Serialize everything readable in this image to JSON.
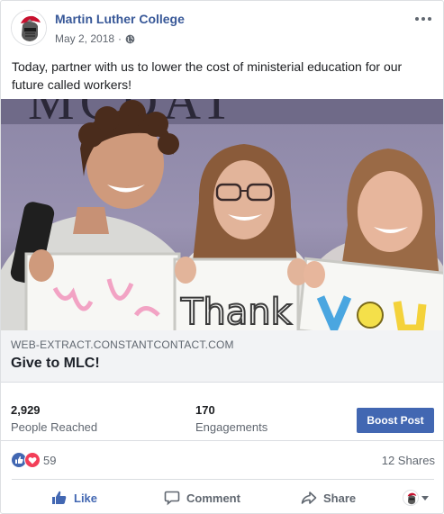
{
  "post": {
    "page_name": "Martin Luther College",
    "date": "May 2, 2018",
    "separator": "·",
    "text": "Today, partner with us to lower the cost of ministerial education for our future called workers!",
    "photo_sign_text": "MCDAT",
    "photo_card_text": "Thank"
  },
  "link_preview": {
    "domain": "WEB-EXTRACT.CONSTANTCONTACT.COM",
    "title": "Give to MLC!"
  },
  "insights": {
    "reached_value": "2,929",
    "reached_label": "People Reached",
    "engagements_value": "170",
    "engagements_label": "Engagements",
    "boost_label": "Boost Post"
  },
  "reactions": {
    "count": "59",
    "shares": "12 Shares",
    "types": [
      "like-icon",
      "love-icon"
    ]
  },
  "actions": {
    "like": "Like",
    "comment": "Comment",
    "share": "Share"
  },
  "colors": {
    "brand_blue": "#4267b2",
    "name_blue": "#385898",
    "love_red": "#f33e58",
    "link_bg": "#f2f3f5"
  }
}
